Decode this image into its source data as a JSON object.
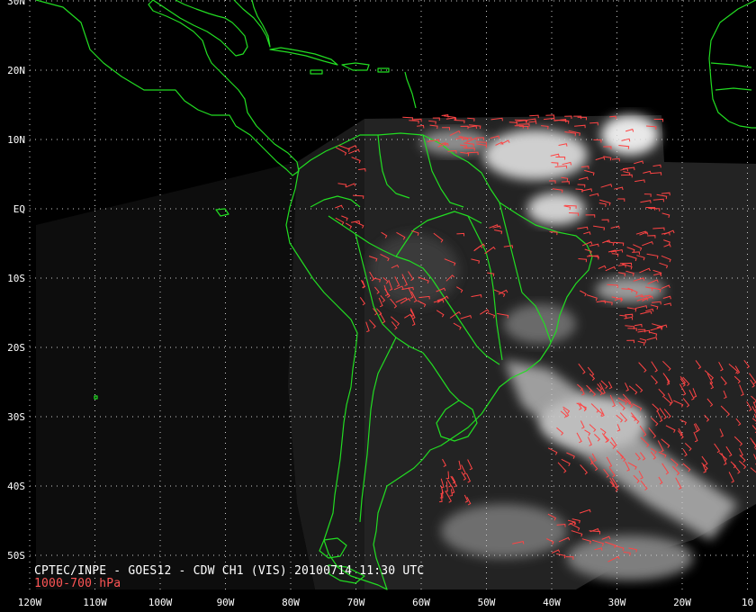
{
  "caption": {
    "title": "CPTEC/INPE - GOES12 - CDW CH1 (VIS) 20100714 11:30 UTC",
    "level": "1000-700 hPa"
  },
  "grid": {
    "latitudes": [
      {
        "lat": 30,
        "label": "30N"
      },
      {
        "lat": 20,
        "label": "20N"
      },
      {
        "lat": 10,
        "label": "10N"
      },
      {
        "lat": 0,
        "label": "EQ"
      },
      {
        "lat": -10,
        "label": "10S"
      },
      {
        "lat": -20,
        "label": "20S"
      },
      {
        "lat": -30,
        "label": "30S"
      },
      {
        "lat": -40,
        "label": "40S"
      },
      {
        "lat": -50,
        "label": "50S"
      }
    ],
    "longitudes": [
      {
        "lon": -120,
        "label": "120W"
      },
      {
        "lon": -110,
        "label": "110W"
      },
      {
        "lon": -100,
        "label": "100W"
      },
      {
        "lon": -90,
        "label": "90W"
      },
      {
        "lon": -80,
        "label": "80W"
      },
      {
        "lon": -70,
        "label": "70W"
      },
      {
        "lon": -60,
        "label": "60W"
      },
      {
        "lon": -50,
        "label": "50W"
      },
      {
        "lon": -40,
        "label": "40W"
      },
      {
        "lon": -30,
        "label": "30W"
      },
      {
        "lon": -20,
        "label": "20W"
      },
      {
        "lon": -10,
        "label": "10"
      }
    ]
  },
  "colors": {
    "background": "#000000",
    "coastline": "#22dd22",
    "wind_vectors": "#ff4444",
    "grid": "#cccccc",
    "labels": "#ffffff",
    "caption_title": "#ffffff",
    "caption_level": "#ff5555",
    "imagery_dark": "#1e1e1e",
    "clouds": "#e8e8e8"
  }
}
